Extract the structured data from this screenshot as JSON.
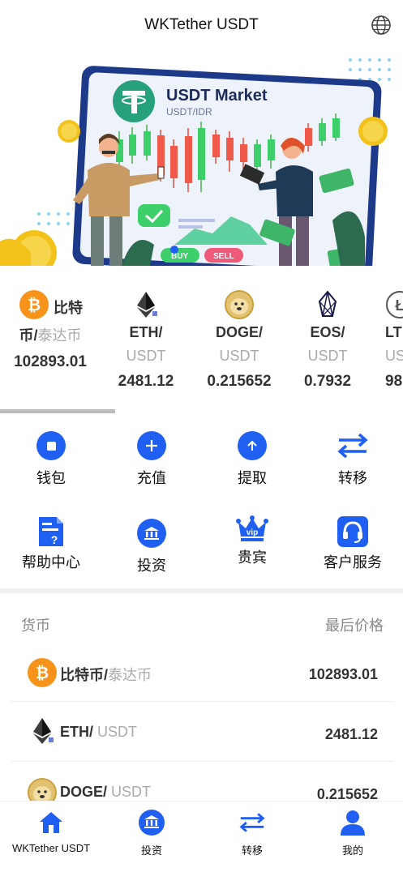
{
  "header": {
    "title": "WKTether USDT",
    "globe_icon": "globe-icon"
  },
  "banner": {
    "title": "USDT Market",
    "subtitle": "USDT/IDR",
    "buy_label": "BUY",
    "sell_label": "SELL"
  },
  "ticker": [
    {
      "name": "比特",
      "name2": "币/",
      "quote": "泰达币",
      "price": "102893.01",
      "icon": "bitcoin-icon"
    },
    {
      "name": "ETH/",
      "quote": "USDT",
      "price": "2481.12",
      "icon": "ethereum-icon"
    },
    {
      "name": "DOGE/",
      "quote": "USDT",
      "price": "0.215652",
      "icon": "dogecoin-icon"
    },
    {
      "name": "EOS/",
      "quote": "USDT",
      "price": "0.7932",
      "icon": "eos-icon"
    },
    {
      "name": "LT",
      "quote": "US",
      "price": "98.",
      "icon": "litecoin-icon"
    }
  ],
  "actions": [
    {
      "label": "钱包",
      "icon": "wallet-icon"
    },
    {
      "label": "充值",
      "icon": "plus-icon"
    },
    {
      "label": "提取",
      "icon": "arrow-up-icon"
    },
    {
      "label": "转移",
      "icon": "transfer-icon"
    },
    {
      "label": "帮助中心",
      "icon": "help-document-icon"
    },
    {
      "label": "投资",
      "icon": "bank-icon"
    },
    {
      "label": "贵宾",
      "icon": "vip-crown-icon"
    },
    {
      "label": "客户服务",
      "icon": "headset-icon"
    }
  ],
  "market": {
    "col_currency": "货币",
    "col_price": "最后价格",
    "rows": [
      {
        "base": "比特币/",
        "quote": "泰达币",
        "price": "102893.01",
        "icon": "bitcoin-icon"
      },
      {
        "base": "ETH/",
        "quote": " USDT",
        "price": "2481.12",
        "icon": "ethereum-icon"
      },
      {
        "base": "DOGE/",
        "quote": " USDT",
        "price": "0.215652",
        "icon": "dogecoin-icon"
      }
    ]
  },
  "nav": [
    {
      "label": "WKTether USDT",
      "icon": "home-icon"
    },
    {
      "label": "投资",
      "icon": "bank-icon"
    },
    {
      "label": "转移",
      "icon": "transfer-icon"
    },
    {
      "label": "我的",
      "icon": "user-icon"
    }
  ],
  "colors": {
    "accent": "#1f5ff2",
    "bitcoin": "#f7931a",
    "tether": "#26a17b"
  }
}
